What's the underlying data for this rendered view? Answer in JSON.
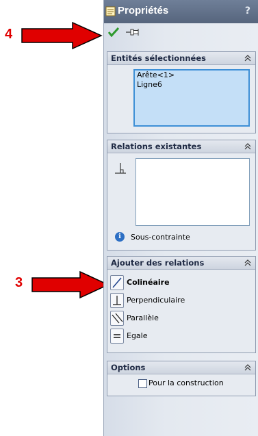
{
  "annotations": {
    "callout_top": "4",
    "callout_bottom": "3",
    "arrow_color": "#e00000"
  },
  "panel": {
    "title": "Propriétés",
    "help": "?",
    "toolbar": {
      "ok_icon": "checkmark-icon",
      "pin_icon": "pushpin-icon"
    }
  },
  "groups": {
    "selected_entities": {
      "title": "Entités sélectionnées",
      "items": [
        "Arête<1>",
        "Ligne6"
      ]
    },
    "existing_relations": {
      "title": "Relations existantes",
      "status": "Sous-contrainte"
    },
    "add_relations": {
      "title": "Ajouter des relations",
      "items": [
        {
          "label": "Colinéaire",
          "icon": "collinear-icon"
        },
        {
          "label": "Perpendiculaire",
          "icon": "perpendicular-icon"
        },
        {
          "label": "Parallèle",
          "icon": "parallel-icon"
        },
        {
          "label": "Egale",
          "icon": "equal-icon"
        }
      ]
    },
    "options": {
      "title": "Options",
      "construction_label": "Pour la construction",
      "construction_checked": false
    }
  }
}
